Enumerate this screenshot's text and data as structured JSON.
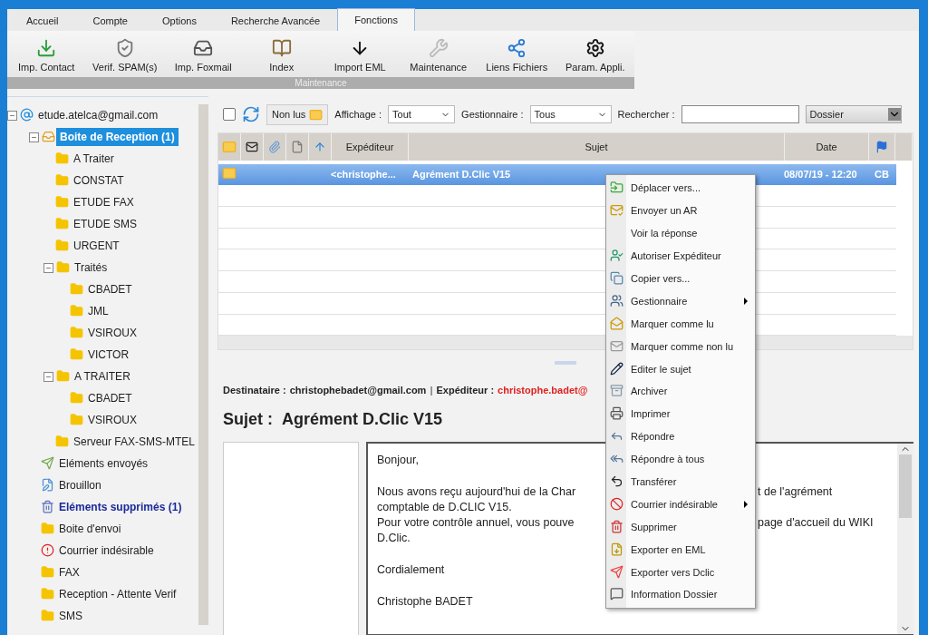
{
  "tabs": [
    {
      "label": "Accueil",
      "selected": false
    },
    {
      "label": "Compte",
      "selected": false
    },
    {
      "label": "Options",
      "selected": false
    },
    {
      "label": "Recherche Avancée",
      "selected": false
    },
    {
      "label": "Fonctions",
      "selected": true
    }
  ],
  "ribbon": {
    "buttons": [
      "Imp. Contact",
      "Verif. SPAM(s)",
      "Imp. Foxmail",
      "Index",
      "Import EML",
      "Maintenance",
      "Liens Fichiers",
      "Param. Appli."
    ],
    "group_label": "Maintenance"
  },
  "tree": [
    {
      "label": "etude.atelca@gmail.com",
      "kind": "account",
      "expanded": true,
      "selected": false,
      "unread": false,
      "children": [
        {
          "label": "Boite de Reception (1)",
          "kind": "inbox",
          "expanded": true,
          "selected": true,
          "unread": true,
          "children": [
            {
              "label": "A Traiter",
              "kind": "folder",
              "selected": false,
              "unread": false
            },
            {
              "label": "CONSTAT",
              "kind": "folder",
              "selected": false,
              "unread": false
            },
            {
              "label": "ETUDE FAX",
              "kind": "folder",
              "selected": false,
              "unread": false
            },
            {
              "label": "ETUDE SMS",
              "kind": "folder",
              "selected": false,
              "unread": false
            },
            {
              "label": "URGENT",
              "kind": "folder",
              "selected": false,
              "unread": false
            },
            {
              "label": "Traités",
              "kind": "folder",
              "expanded": true,
              "selected": false,
              "unread": false,
              "children": [
                {
                  "label": "CBADET",
                  "kind": "folder",
                  "selected": false,
                  "unread": false
                },
                {
                  "label": "JML",
                  "kind": "folder",
                  "selected": false,
                  "unread": false
                },
                {
                  "label": "VSIROUX",
                  "kind": "folder",
                  "selected": false,
                  "unread": false
                },
                {
                  "label": "VICTOR",
                  "kind": "folder",
                  "selected": false,
                  "unread": false
                }
              ]
            },
            {
              "label": "A TRAITER",
              "kind": "folder",
              "expanded": true,
              "selected": false,
              "unread": false,
              "children": [
                {
                  "label": "CBADET",
                  "kind": "folder",
                  "selected": false,
                  "unread": false
                },
                {
                  "label": "VSIROUX",
                  "kind": "folder",
                  "selected": false,
                  "unread": false
                }
              ]
            },
            {
              "label": "Serveur FAX-SMS-MTEL",
              "kind": "folder",
              "selected": false,
              "unread": false
            }
          ]
        },
        {
          "label": "Eléments envoyés",
          "kind": "sent",
          "selected": false,
          "unread": false
        },
        {
          "label": "Brouillon",
          "kind": "draft",
          "selected": false,
          "unread": false
        },
        {
          "label": "Eléments supprimés (1)",
          "kind": "trash",
          "selected": false,
          "unread": true
        },
        {
          "label": "Boite d'envoi",
          "kind": "folder",
          "selected": false,
          "unread": false
        },
        {
          "label": "Courrier indésirable",
          "kind": "junk",
          "selected": false,
          "unread": false
        },
        {
          "label": "FAX",
          "kind": "folder",
          "selected": false,
          "unread": false
        },
        {
          "label": "Reception - Attente Verif",
          "kind": "folder",
          "selected": false,
          "unread": false
        },
        {
          "label": "SMS",
          "kind": "folder",
          "selected": false,
          "unread": false
        }
      ]
    }
  ],
  "toolbar": {
    "select_all": {
      "checked": false
    },
    "unread_button": "Non lus",
    "display_label": "Affichage :",
    "display_value": "Tout",
    "manager_label": "Gestionnaire :",
    "manager_value": "Tous",
    "search_label": "Rechercher :",
    "scope_value": "Dossier"
  },
  "message_list": {
    "columns": [
      "Expéditeur",
      "Sujet",
      "Date"
    ],
    "rows": [
      {
        "sender": "<christophe...",
        "subject": "Agrément D.Clic V15",
        "date": "08/07/19 - 12:20",
        "manager": "CB",
        "selected": true
      }
    ]
  },
  "preview": {
    "recipient_label": "Destinataire :",
    "recipient": "christophebadet@gmail.com",
    "sender_label": "Expéditeur :",
    "sender": "christophe.badet@",
    "subject_label": "Sujet :",
    "subject": "Agrément D.Clic V15",
    "separator": "|",
    "body": [
      [
        {
          "left": "Bonjour,"
        }
      ],
      [
        {
          "left": "Nous avons reçu aujourd'hui de la Char",
          "right": "t de l'agrément"
        },
        {
          "left": "comptable de D.CLIC V15."
        },
        {
          "left": "Pour votre contrôle annuel, vous pouve",
          "right": "page d'accueil du WIKI"
        },
        {
          "left": "D.Clic."
        }
      ],
      [
        {
          "left": "Cordialement"
        }
      ],
      [
        {
          "left": "Christophe BADET"
        }
      ]
    ]
  },
  "context_menu": [
    {
      "label": "Déplacer vers...",
      "submenu": false
    },
    {
      "label": "Envoyer un AR",
      "submenu": false
    },
    {
      "label": "Voir la réponse",
      "submenu": false
    },
    {
      "label": "Autoriser Expéditeur",
      "submenu": false
    },
    {
      "label": "Copier vers...",
      "submenu": false
    },
    {
      "label": "Gestionnaire",
      "submenu": true
    },
    {
      "label": "Marquer comme lu",
      "submenu": false
    },
    {
      "label": "Marquer comme non lu",
      "submenu": false
    },
    {
      "label": "Editer le sujet",
      "submenu": false
    },
    {
      "label": "Archiver",
      "submenu": false
    },
    {
      "label": "Imprimer",
      "submenu": false
    },
    {
      "label": "Répondre",
      "submenu": false
    },
    {
      "label": "Répondre à tous",
      "submenu": false
    },
    {
      "label": "Transférer",
      "submenu": false
    },
    {
      "label": "Courrier indésirable",
      "submenu": true
    },
    {
      "label": "Supprimer",
      "submenu": false
    },
    {
      "label": "Exporter en EML",
      "submenu": false
    },
    {
      "label": "Exporter vers Dclic",
      "submenu": false
    },
    {
      "label": "Information Dossier",
      "submenu": false
    }
  ]
}
